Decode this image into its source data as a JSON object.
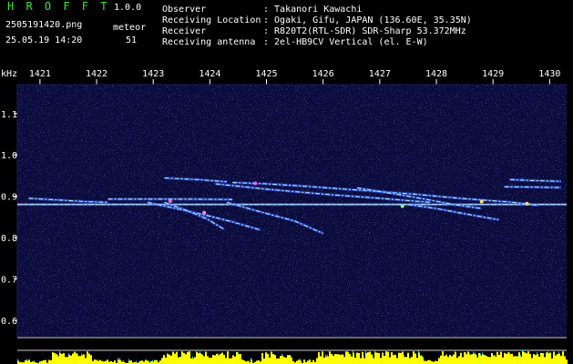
{
  "app": {
    "name": "H R O F F T",
    "version": "1.0.0"
  },
  "file": {
    "name": "2505191420.png",
    "datetime": "25.05.19 14:20"
  },
  "counter": {
    "label": "meteor",
    "value": "51"
  },
  "info": [
    {
      "key": "Observer",
      "value": ": Takanori Kawachi"
    },
    {
      "key": "Receiving Location",
      "value": ": Ogaki, Gifu, JAPAN (136.60E, 35.35N)"
    },
    {
      "key": "Receiver",
      "value": ": R820T2(RTL-SDR) SDR-Sharp 53.372MHz"
    },
    {
      "key": "Receiving antenna",
      "value": ": 2el-HB9CV Vertical (el. E-W)"
    }
  ],
  "colors": {
    "accent": "#39e639",
    "background": "#000000",
    "plot_bg": "#0a0a3a",
    "signal": "#3f7bff",
    "bars": "#ffff00"
  },
  "chart_data": {
    "type": "spectrogram",
    "ylabel": "kHz",
    "x_ticks": [
      "1421",
      "1422",
      "1423",
      "1424",
      "1425",
      "1426",
      "1427",
      "1428",
      "1429",
      "1430"
    ],
    "x_range": [
      1420.6,
      1430.3
    ],
    "y_ticks": [
      "1.1",
      "1.0",
      "0.9",
      "0.8",
      "0.7",
      "0.6"
    ],
    "y_range": [
      0.56,
      1.17
    ],
    "carrier_khz": 0.88,
    "traces": [
      {
        "x": [
          1422.2,
          1423.5,
          1424.4
        ],
        "y": [
          0.893,
          0.893,
          0.892
        ]
      },
      {
        "x": [
          1424.4,
          1425.0,
          1425.6,
          1426.6,
          1427.6,
          1428.4,
          1429.3,
          1429.8
        ],
        "y": [
          0.933,
          0.93,
          0.925,
          0.915,
          0.905,
          0.895,
          0.886,
          0.878
        ]
      },
      {
        "x": [
          1424.1,
          1425.0,
          1426.0,
          1427.0,
          1427.9
        ],
        "y": [
          0.93,
          0.917,
          0.905,
          0.895,
          0.885
        ]
      },
      {
        "x": [
          1426.6,
          1427.2,
          1427.8,
          1428.3,
          1428.8
        ],
        "y": [
          0.92,
          0.907,
          0.893,
          0.88,
          0.87
        ]
      },
      {
        "x": [
          1422.9,
          1423.4,
          1423.9,
          1424.4,
          1424.9
        ],
        "y": [
          0.885,
          0.87,
          0.855,
          0.838,
          0.818
        ]
      },
      {
        "x": [
          1423.2,
          1423.6,
          1423.95,
          1424.25
        ],
        "y": [
          0.885,
          0.865,
          0.845,
          0.82
        ]
      },
      {
        "x": [
          1424.3,
          1424.9,
          1425.5,
          1426.0
        ],
        "y": [
          0.885,
          0.862,
          0.84,
          0.81
        ]
      },
      {
        "x": [
          1427.5,
          1428.0,
          1428.6,
          1429.1
        ],
        "y": [
          0.88,
          0.87,
          0.855,
          0.843
        ]
      },
      {
        "x": [
          1420.8,
          1421.3,
          1421.8,
          1422.2
        ],
        "y": [
          0.895,
          0.891,
          0.887,
          0.885
        ]
      },
      {
        "x": [
          1429.3,
          1429.7,
          1430.2
        ],
        "y": [
          0.94,
          0.938,
          0.936
        ]
      },
      {
        "x": [
          1429.2,
          1429.7,
          1430.2
        ],
        "y": [
          0.923,
          0.922,
          0.921
        ]
      },
      {
        "x": [
          1423.2,
          1423.8,
          1424.3
        ],
        "y": [
          0.944,
          0.94,
          0.935
        ]
      }
    ]
  }
}
